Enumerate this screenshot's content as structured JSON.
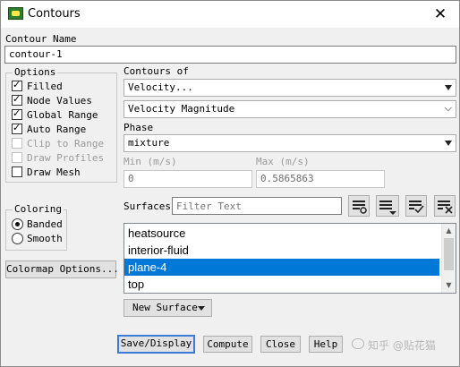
{
  "window": {
    "title": "Contours",
    "close_icon": "close-icon",
    "app_icon": "fluent-app-icon"
  },
  "contour_name": {
    "label": "Contour Name",
    "value": "contour-1"
  },
  "options": {
    "title": "Options",
    "items": [
      {
        "label": "Filled",
        "checked": true,
        "enabled": true
      },
      {
        "label": "Node Values",
        "checked": true,
        "enabled": true
      },
      {
        "label": "Global Range",
        "checked": true,
        "enabled": true
      },
      {
        "label": "Auto Range",
        "checked": true,
        "enabled": true
      },
      {
        "label": "Clip to Range",
        "checked": false,
        "enabled": false
      },
      {
        "label": "Draw Profiles",
        "checked": false,
        "enabled": false
      },
      {
        "label": "Draw Mesh",
        "checked": false,
        "enabled": true
      }
    ]
  },
  "coloring": {
    "title": "Coloring",
    "items": [
      {
        "label": "Banded",
        "selected": true
      },
      {
        "label": "Smooth",
        "selected": false
      }
    ]
  },
  "colormap_button": "Colormap Options...",
  "contours_of": {
    "label": "Contours of",
    "category": "Velocity...",
    "quantity": "Velocity Magnitude"
  },
  "phase": {
    "label": "Phase",
    "value": "mixture"
  },
  "range": {
    "min_label": "Min (m/s)",
    "min_value": "0",
    "max_label": "Max (m/s)",
    "max_value": "0.5865863"
  },
  "surfaces": {
    "label": "Surfaces",
    "filter_placeholder": "Filter Text",
    "items": [
      "heatsource",
      "interior-fluid",
      "plane-4",
      "top"
    ],
    "selected_index": 2,
    "new_surface_label": "New Surface"
  },
  "buttons": {
    "save_display": "Save/Display",
    "compute": "Compute",
    "close": "Close",
    "help": "Help"
  },
  "watermark": "知乎 @贴花猫",
  "colors": {
    "selection": "#0078d7",
    "default_button_border": "#3a7bd5",
    "window_bg": "#f0f0f0"
  }
}
